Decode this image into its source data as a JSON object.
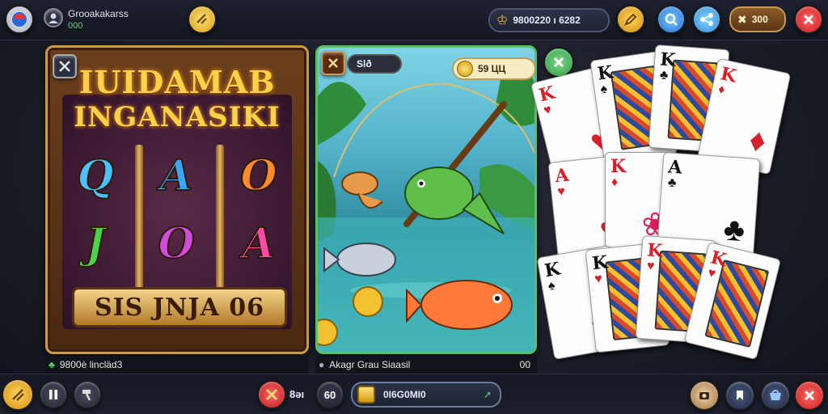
{
  "topbar": {
    "profile_name": "Grooakakarss",
    "profile_sub": "000",
    "balance_text": "9800220 ı 6282",
    "score_text": "300"
  },
  "slot": {
    "title_line1": "IUIDAMAB",
    "title_line2": "INGANASIKI",
    "symbols": [
      "Q",
      "A",
      "O",
      "J",
      "O",
      "A"
    ],
    "win_text": "SIS JNJA 06",
    "caption": "9800è lincläd3"
  },
  "fishing": {
    "tab_label": "Slð",
    "coin_text": "59 ЦЦ",
    "caption": "Akagr Grau Siaasil",
    "caption_value": "00"
  },
  "cards": {
    "ranks": [
      "K",
      "K",
      "K",
      "K",
      "A",
      "K",
      "A",
      "K",
      "K",
      "K",
      "K"
    ]
  },
  "bottombar": {
    "count_text": "8əı",
    "chip_text": "60",
    "coin_total": "0I6G0MI0"
  },
  "colors": {
    "accent_gold": "#f0b429",
    "close_red": "#d8202a",
    "panel_green": "#5bbf6a"
  }
}
